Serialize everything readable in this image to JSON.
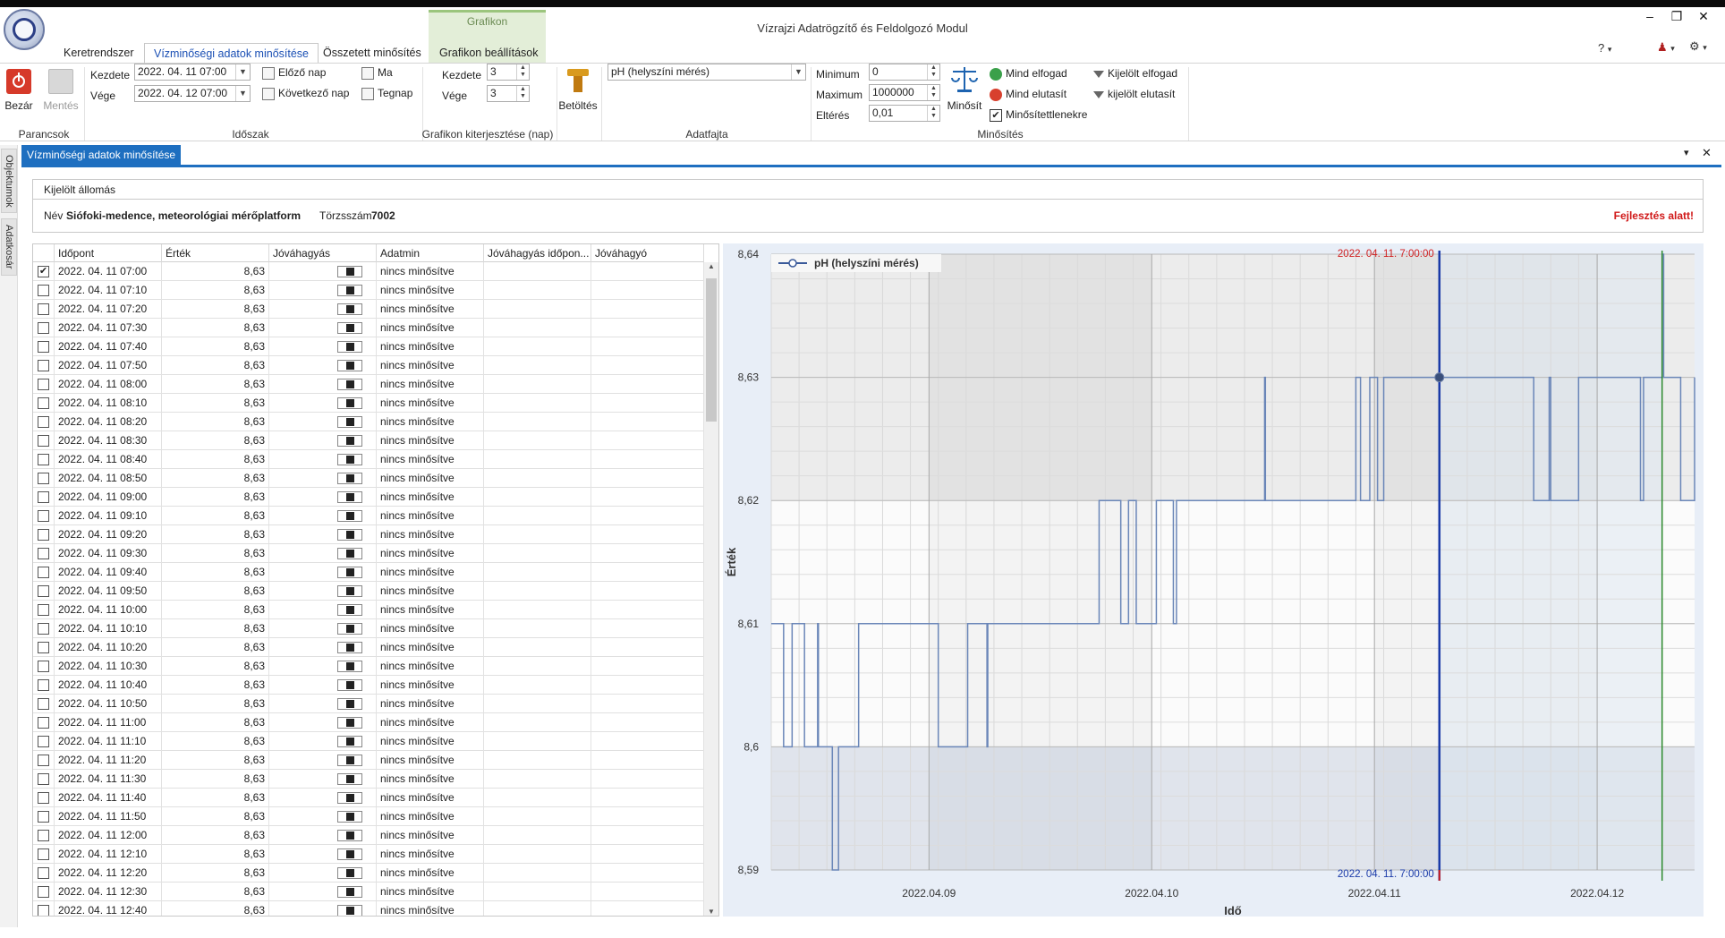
{
  "window": {
    "title": "Vízrajzi Adatrögzítő és Feldolgozó Modul",
    "minimize": "–",
    "maximize": "❐",
    "close": "✕"
  },
  "help": {
    "question": "?",
    "user": "♟",
    "gear": "⚙",
    "caret": "▾"
  },
  "tabs": [
    {
      "label": "Keretrendszer"
    },
    {
      "label": "Vízminőségi adatok minősítése"
    },
    {
      "label": "Összetett minősítés"
    },
    {
      "label": "Grafikon beállítások"
    }
  ],
  "context_group": "Grafikon",
  "ribbon": {
    "close_label": "Bezár",
    "save_label": "Mentés",
    "commands_label": "Parancsok",
    "start_label": "Kezdete",
    "end_label": "Vége",
    "start_value": "2022. 04. 11 07:00",
    "end_value": "2022. 04. 12 07:00",
    "prev_day": "Előző nap",
    "next_day": "Következő nap",
    "today": "Ma",
    "yesterday": "Tegnap",
    "periods_label": "Időszak",
    "ext_start_label": "Kezdete",
    "ext_end_label": "Vége",
    "ext_start_value": "3",
    "ext_end_value": "3",
    "extension_label": "Grafikon kiterjesztése (nap)",
    "load_label": "Betöltés",
    "datatype_value": "pH (helyszíni mérés)",
    "datatype_label": "Adatfajta",
    "min_label": "Minimum",
    "max_label": "Maximum",
    "dev_label": "Eltérés",
    "min_value": "0",
    "max_value": "1000000",
    "dev_value": "0,01",
    "qualify_label": "Minősít",
    "accept_all": "Mind elfogad",
    "reject_all": "Mind elutasít",
    "unqualified_only": "Minősítettlenekre",
    "accept_selected": "Kijelölt elfogad",
    "reject_selected": "kijelölt elutasít",
    "qualification_label": "Minősítés"
  },
  "doc_tab": "Vízminőségi adatok minősítése",
  "side_tabs": {
    "objects": "Objektumok",
    "datacart": "Adatkosár"
  },
  "doc_controls": {
    "dropdown": "▾",
    "close": "✕"
  },
  "station": {
    "header": "Kijelölt állomás",
    "name_label": "Név",
    "name_value": "Siófoki-medence, meteorológiai mérőplatform",
    "id_label": "Törzsszám",
    "id_value": "7002",
    "dev_notice": "Fejlesztés alatt!"
  },
  "grid": {
    "headers": [
      "Időpont",
      "Érték",
      "Jóváhagyás",
      "Adatmin",
      "Jóváhagyás időpon...",
      "Jóváhagyó"
    ],
    "rows": [
      {
        "time": "2022. 04. 11 07:00",
        "value": "8,63",
        "status": "nincs minősítve",
        "checked": true
      },
      {
        "time": "2022. 04. 11 07:10",
        "value": "8,63",
        "status": "nincs minősítve",
        "checked": false
      },
      {
        "time": "2022. 04. 11 07:20",
        "value": "8,63",
        "status": "nincs minősítve",
        "checked": false
      },
      {
        "time": "2022. 04. 11 07:30",
        "value": "8,63",
        "status": "nincs minősítve",
        "checked": false
      },
      {
        "time": "2022. 04. 11 07:40",
        "value": "8,63",
        "status": "nincs minősítve",
        "checked": false
      },
      {
        "time": "2022. 04. 11 07:50",
        "value": "8,63",
        "status": "nincs minősítve",
        "checked": false
      },
      {
        "time": "2022. 04. 11 08:00",
        "value": "8,63",
        "status": "nincs minősítve",
        "checked": false
      },
      {
        "time": "2022. 04. 11 08:10",
        "value": "8,63",
        "status": "nincs minősítve",
        "checked": false
      },
      {
        "time": "2022. 04. 11 08:20",
        "value": "8,63",
        "status": "nincs minősítve",
        "checked": false
      },
      {
        "time": "2022. 04. 11 08:30",
        "value": "8,63",
        "status": "nincs minősítve",
        "checked": false
      },
      {
        "time": "2022. 04. 11 08:40",
        "value": "8,63",
        "status": "nincs minősítve",
        "checked": false
      },
      {
        "time": "2022. 04. 11 08:50",
        "value": "8,63",
        "status": "nincs minősítve",
        "checked": false
      },
      {
        "time": "2022. 04. 11 09:00",
        "value": "8,63",
        "status": "nincs minősítve",
        "checked": false
      },
      {
        "time": "2022. 04. 11 09:10",
        "value": "8,63",
        "status": "nincs minősítve",
        "checked": false
      },
      {
        "time": "2022. 04. 11 09:20",
        "value": "8,63",
        "status": "nincs minősítve",
        "checked": false
      },
      {
        "time": "2022. 04. 11 09:30",
        "value": "8,63",
        "status": "nincs minősítve",
        "checked": false
      },
      {
        "time": "2022. 04. 11 09:40",
        "value": "8,63",
        "status": "nincs minősítve",
        "checked": false
      },
      {
        "time": "2022. 04. 11 09:50",
        "value": "8,63",
        "status": "nincs minősítve",
        "checked": false
      },
      {
        "time": "2022. 04. 11 10:00",
        "value": "8,63",
        "status": "nincs minősítve",
        "checked": false
      },
      {
        "time": "2022. 04. 11 10:10",
        "value": "8,63",
        "status": "nincs minősítve",
        "checked": false
      },
      {
        "time": "2022. 04. 11 10:20",
        "value": "8,63",
        "status": "nincs minősítve",
        "checked": false
      },
      {
        "time": "2022. 04. 11 10:30",
        "value": "8,63",
        "status": "nincs minősítve",
        "checked": false
      },
      {
        "time": "2022. 04. 11 10:40",
        "value": "8,63",
        "status": "nincs minősítve",
        "checked": false
      },
      {
        "time": "2022. 04. 11 10:50",
        "value": "8,63",
        "status": "nincs minősítve",
        "checked": false
      },
      {
        "time": "2022. 04. 11 11:00",
        "value": "8,63",
        "status": "nincs minősítve",
        "checked": false
      },
      {
        "time": "2022. 04. 11 11:10",
        "value": "8,63",
        "status": "nincs minősítve",
        "checked": false
      },
      {
        "time": "2022. 04. 11 11:20",
        "value": "8,63",
        "status": "nincs minősítve",
        "checked": false
      },
      {
        "time": "2022. 04. 11 11:30",
        "value": "8,63",
        "status": "nincs minősítve",
        "checked": false
      },
      {
        "time": "2022. 04. 11 11:40",
        "value": "8,63",
        "status": "nincs minősítve",
        "checked": false
      },
      {
        "time": "2022. 04. 11 11:50",
        "value": "8,63",
        "status": "nincs minősítve",
        "checked": false
      },
      {
        "time": "2022. 04. 11 12:00",
        "value": "8,63",
        "status": "nincs minősítve",
        "checked": false
      },
      {
        "time": "2022. 04. 11 12:10",
        "value": "8,63",
        "status": "nincs minősítve",
        "checked": false
      },
      {
        "time": "2022. 04. 11 12:20",
        "value": "8,63",
        "status": "nincs minősítve",
        "checked": false
      },
      {
        "time": "2022. 04. 11 12:30",
        "value": "8,63",
        "status": "nincs minősítve",
        "checked": false
      },
      {
        "time": "2022. 04. 11 12:40",
        "value": "8,63",
        "status": "nincs minősítve",
        "checked": false
      }
    ]
  },
  "chart_data": {
    "type": "line",
    "series": [
      {
        "name": "pH (helyszíni mérés)",
        "x": [
          "2022-04-08 07:00",
          "2022-04-08 08:15",
          "2022-04-08 08:20",
          "2022-04-08 09:10",
          "2022-04-08 09:15",
          "2022-04-08 10:30",
          "2022-04-08 10:35",
          "2022-04-08 11:00",
          "2022-04-08 12:00",
          "2022-04-08 12:05",
          "2022-04-08 13:30",
          "2022-04-08 13:35",
          "2022-04-08 14:10",
          "2022-04-08 14:15",
          "2022-04-08 14:50",
          "2022-04-08 15:05",
          "2022-04-08 16:20",
          "2022-04-08 16:25",
          "2022-04-08 17:30",
          "2022-04-09 00:30",
          "2022-04-09 01:00",
          "2022-04-09 04:10",
          "2022-04-09 05:20",
          "2022-04-09 06:15",
          "2022-04-09 06:20",
          "2022-04-09 07:00",
          "2022-04-09 10:40",
          "2022-04-09 11:30",
          "2022-04-09 18:20",
          "2022-04-09 20:40",
          "2022-04-09 21:30",
          "2022-04-09 22:20",
          "2022-04-10 00:30",
          "2022-04-10 01:00",
          "2022-04-10 02:20",
          "2022-04-10 02:40",
          "2022-04-10 21:30",
          "2022-04-10 03:00",
          "2022-04-10 04:00",
          "2022-04-10 04:10",
          "2022-04-10 12:10",
          "2022-04-10 12:15",
          "2022-04-10 13:00",
          "2022-04-10 22:00",
          "2022-04-10 22:30",
          "2022-04-10 23:30",
          "2022-04-11 00:20",
          "2022-04-11 01:00",
          "2022-04-11 07:00",
          "2022-04-11 16:20",
          "2022-04-11 17:10",
          "2022-04-11 18:50",
          "2022-04-11 19:00",
          "2022-04-11 22:00",
          "2022-04-11 22:15",
          "2022-04-12 04:40",
          "2022-04-12 05:00",
          "2022-04-12 05:40",
          "2022-04-12 06:10",
          "2022-04-12 07:00",
          "2022-04-12 07:10",
          "2022-04-12 08:20",
          "2022-04-12 09:00",
          "2022-04-12 10:30"
        ],
        "y": [
          8.61,
          8.61,
          8.6,
          8.6,
          8.61,
          8.61,
          8.6,
          8.6,
          8.61,
          8.6,
          8.6,
          8.59,
          8.59,
          8.6,
          8.6,
          8.6,
          8.6,
          8.61,
          8.61,
          8.61,
          8.6,
          8.61,
          8.61,
          8.6,
          8.61,
          8.61,
          8.61,
          8.61,
          8.62,
          8.61,
          8.62,
          8.61,
          8.62,
          8.62,
          8.61,
          8.62,
          8.62,
          8.62,
          8.62,
          8.62,
          8.63,
          8.62,
          8.62,
          8.63,
          8.62,
          8.63,
          8.62,
          8.63,
          8.63,
          8.63,
          8.62,
          8.63,
          8.62,
          8.63,
          8.63,
          8.62,
          8.63,
          8.63,
          8.63,
          8.64,
          8.63,
          8.63,
          8.62,
          8.63
        ]
      }
    ],
    "xlabel": "Idő",
    "ylabel": "Érték",
    "x_ticks": [
      "2022.04.09",
      "2022.04.10",
      "2022.04.11",
      "2022.04.12"
    ],
    "y_ticks": [
      "8,59",
      "8,6",
      "8,61",
      "8,62",
      "8,63",
      "8,64"
    ],
    "ylim": [
      8.59,
      8.64
    ],
    "xlim": [
      "2022-04-08 07:00",
      "2022-04-12 10:30"
    ],
    "grid": true,
    "legend": "top-left",
    "marker_start": "2022. 04. 11. 7:00:00",
    "marker_end": "2022. 04. 11. 7:00:00",
    "marker_color": "#1a3aa8",
    "end_marker_color": "#2e8b2e",
    "line_color": "#6a86b8"
  }
}
